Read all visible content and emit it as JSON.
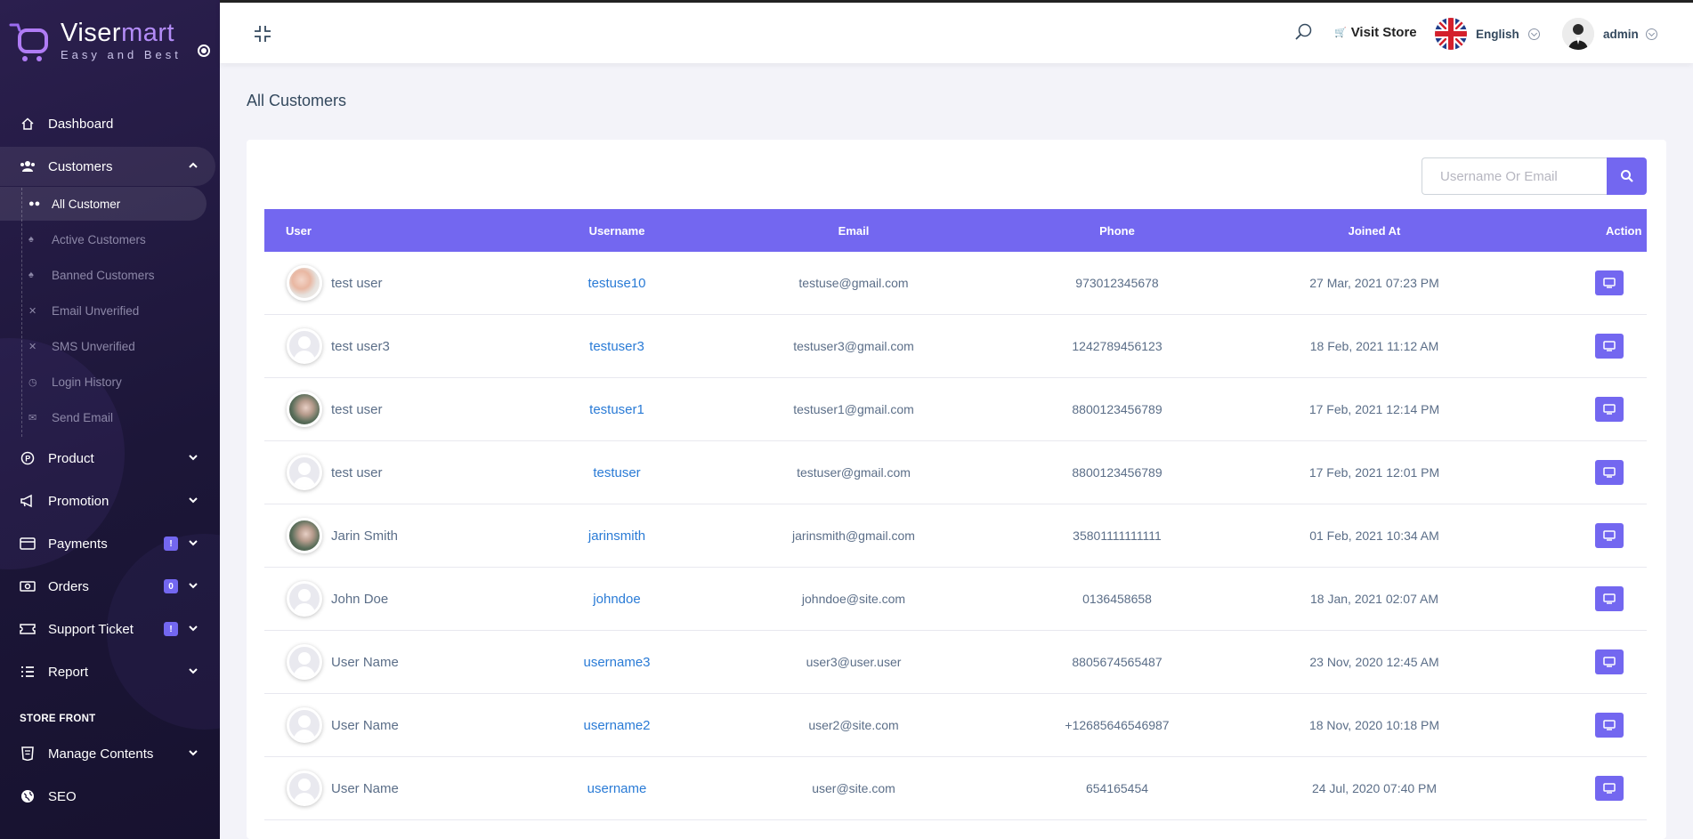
{
  "brand": {
    "name_a": "Viser",
    "name_b": "mart",
    "tagline": "Easy and Best"
  },
  "sidebar": {
    "items": [
      {
        "label": "Dashboard",
        "icon": "home-icon"
      },
      {
        "label": "Customers",
        "icon": "users-icon",
        "expanded": true
      },
      {
        "label": "Product",
        "icon": "product-icon"
      },
      {
        "label": "Promotion",
        "icon": "megaphone-icon"
      },
      {
        "label": "Payments",
        "icon": "credit-card-icon",
        "badge": "!"
      },
      {
        "label": "Orders",
        "icon": "money-icon",
        "badge": "0"
      },
      {
        "label": "Support Ticket",
        "icon": "ticket-icon",
        "badge": "!"
      },
      {
        "label": "Report",
        "icon": "list-icon"
      }
    ],
    "sub_items": [
      {
        "label": "All Customer",
        "active": true
      },
      {
        "label": "Active Customers"
      },
      {
        "label": "Banned Customers"
      },
      {
        "label": "Email Unverified"
      },
      {
        "label": "SMS Unverified"
      },
      {
        "label": "Login History"
      },
      {
        "label": "Send Email"
      }
    ],
    "section_title": "STORE FRONT",
    "store_items": [
      {
        "label": "Manage Contents",
        "icon": "html5-icon"
      },
      {
        "label": "SEO",
        "icon": "globe-icon"
      }
    ]
  },
  "topbar": {
    "visit_store": "Visit Store",
    "language": "English",
    "user": "admin"
  },
  "page": {
    "title": "All Customers"
  },
  "search": {
    "placeholder": "Username Or Email"
  },
  "table": {
    "headers": [
      "User",
      "Username",
      "Email",
      "Phone",
      "Joined At",
      "Action"
    ],
    "rows": [
      {
        "name": "test user",
        "username": "testuse10",
        "email": "testuse@gmail.com",
        "phone": "973012345678",
        "joined": "27 Mar, 2021 07:23 PM",
        "avatar": "photo1"
      },
      {
        "name": "test user3",
        "username": "testuser3",
        "email": "testuser3@gmail.com",
        "phone": "1242789456123",
        "joined": "18 Feb, 2021 11:12 AM",
        "avatar": "default"
      },
      {
        "name": "test user",
        "username": "testuser1",
        "email": "testuser1@gmail.com",
        "phone": "8800123456789",
        "joined": "17 Feb, 2021 12:14 PM",
        "avatar": "photo2"
      },
      {
        "name": "test user",
        "username": "testuser",
        "email": "testuser@gmail.com",
        "phone": "8800123456789",
        "joined": "17 Feb, 2021 12:01 PM",
        "avatar": "default"
      },
      {
        "name": "Jarin Smith",
        "username": "jarinsmith",
        "email": "jarinsmith@gmail.com",
        "phone": "35801111111111",
        "joined": "01 Feb, 2021 10:34 AM",
        "avatar": "photo2"
      },
      {
        "name": "John Doe",
        "username": "johndoe",
        "email": "johndoe@site.com",
        "phone": "0136458658",
        "joined": "18 Jan, 2021 02:07 AM",
        "avatar": "default"
      },
      {
        "name": "User Name",
        "username": "username3",
        "email": "user3@user.user",
        "phone": "8805674565487",
        "joined": "23 Nov, 2020 12:45 AM",
        "avatar": "default"
      },
      {
        "name": "User Name",
        "username": "username2",
        "email": "user2@site.com",
        "phone": "+12685646546987",
        "joined": "18 Nov, 2020 10:18 PM",
        "avatar": "default"
      },
      {
        "name": "User Name",
        "username": "username",
        "email": "user@site.com",
        "phone": "654165454",
        "joined": "24 Jul, 2020 07:40 PM",
        "avatar": "default"
      }
    ]
  },
  "colors": {
    "accent": "#7367f0",
    "sidebar": "#1c1638",
    "link": "#2a7bd6"
  }
}
